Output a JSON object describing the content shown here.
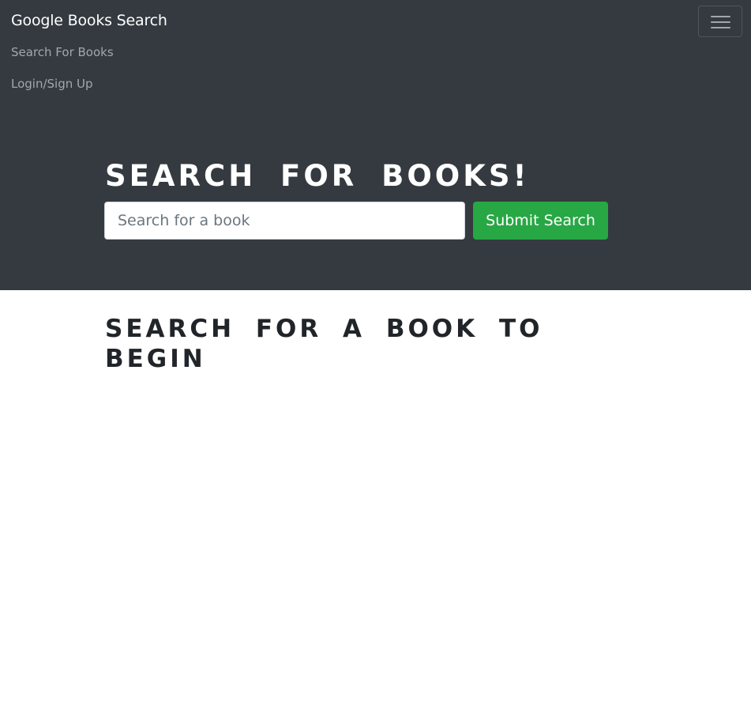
{
  "navbar": {
    "brand": "Google Books Search",
    "links": [
      "Search For Books",
      "Login/Sign Up"
    ],
    "toggler_icon": "hamburger-icon"
  },
  "jumbotron": {
    "title": "SEARCH FOR BOOKS!",
    "search": {
      "placeholder": "Search for a book",
      "value": ""
    },
    "submit_label": "Submit Search"
  },
  "results": {
    "title": "SEARCH FOR A BOOK TO BEGIN"
  },
  "colors": {
    "navbar_bg": "#343a40",
    "submit_bg": "#28a745",
    "heading_dark": "#212529"
  }
}
